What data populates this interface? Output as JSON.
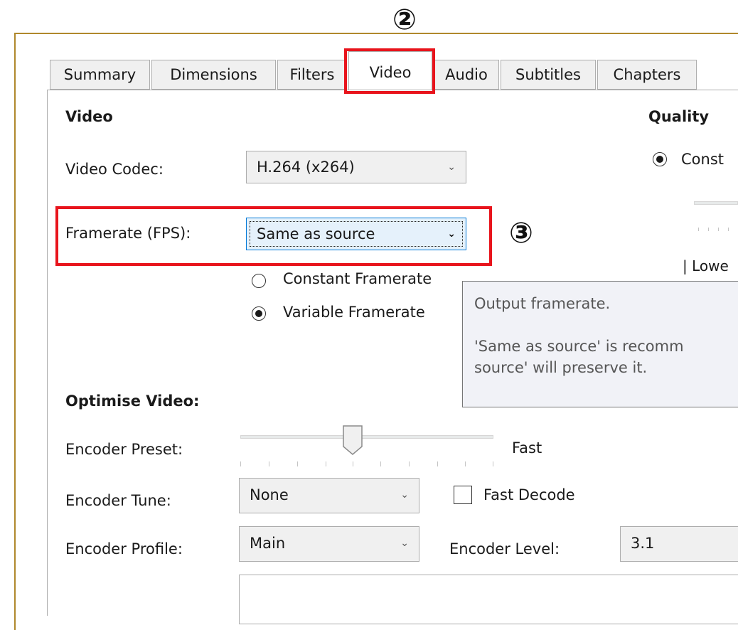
{
  "annotations": {
    "tab_marker": "②",
    "framerate_marker": "③"
  },
  "tabs": [
    {
      "label": "Summary"
    },
    {
      "label": "Dimensions"
    },
    {
      "label": "Filters"
    },
    {
      "label": "Video"
    },
    {
      "label": "Audio"
    },
    {
      "label": "Subtitles"
    },
    {
      "label": "Chapters"
    }
  ],
  "video_section": {
    "heading": "Video",
    "codec_label": "Video Codec:",
    "codec_value": "H.264 (x264)",
    "framerate_label": "Framerate (FPS):",
    "framerate_value": "Same as source",
    "radio_constant": "Constant Framerate",
    "radio_variable": "Variable Framerate",
    "selected_framerate_mode": "Variable Framerate"
  },
  "quality_section": {
    "heading": "Quality",
    "radio_label": "Const",
    "slider_label": "| Lowe"
  },
  "tooltip": {
    "line1": "Output framerate.",
    "line2": "'Same as source' is recomm",
    "line3": "source' will preserve it."
  },
  "optimise": {
    "heading": "Optimise Video:",
    "preset_label": "Encoder Preset:",
    "preset_value": "Fast",
    "tune_label": "Encoder Tune:",
    "tune_value": "None",
    "fast_decode_label": "Fast Decode",
    "fast_decode_checked": false,
    "profile_label": "Encoder Profile:",
    "profile_value": "Main",
    "level_label": "Encoder Level:",
    "level_value": "3.1"
  },
  "icons": {
    "dropdown": "chevron-down-icon"
  },
  "colors": {
    "annotation_red": "#e8141c",
    "focus_blue": "#0078d7",
    "tooltip_bg": "#f1f2f7"
  }
}
